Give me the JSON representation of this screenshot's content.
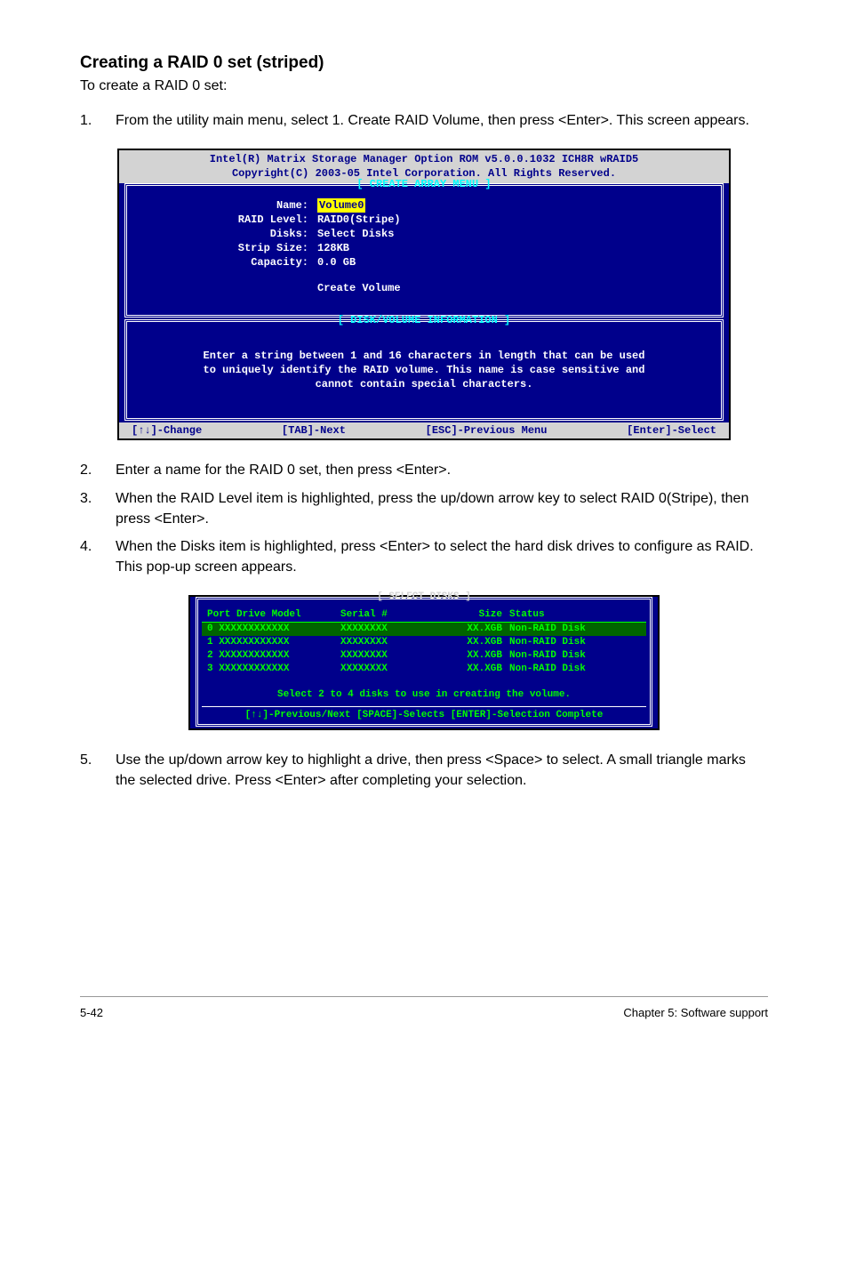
{
  "heading": "Creating a RAID 0 set (striped)",
  "intro": "To create a RAID 0 set:",
  "steps1": [
    {
      "num": "1.",
      "text": "From the utility main menu, select 1. Create RAID Volume, then press <Enter>. This screen appears."
    }
  ],
  "bios1": {
    "header1": "Intel(R) Matrix Storage Manager Option ROM v5.0.0.1032 ICH8R wRAID5",
    "header2": "Copyright(C) 2003-05 Intel Corporation. All Rights Reserved.",
    "menu_title": "[ CREATE ARRAY MENU ]",
    "fields": {
      "name_label": "Name:",
      "name_value": "Volume0",
      "raid_level_label": "RAID Level:",
      "raid_level_value": "RAID0(Stripe)",
      "disks_label": "Disks:",
      "disks_value": "Select Disks",
      "strip_label": "Strip Size:",
      "strip_value": "128KB",
      "capacity_label": "Capacity:",
      "capacity_value": "0.0   GB",
      "create_volume": "Create Volume"
    },
    "info_title": "[ DISK/VOLUME INFORMATION ]",
    "info_text1": "Enter a string between 1 and 16 characters in length that can be used",
    "info_text2": "to uniquely identify the RAID volume. This name is case sensitive and",
    "info_text3": "cannot contain special characters.",
    "footer": {
      "a": "[↑↓]-Change",
      "b": "[TAB]-Next",
      "c": "[ESC]-Previous Menu",
      "d": "[Enter]-Select"
    }
  },
  "steps2": [
    {
      "num": "2.",
      "text": "Enter a name for the RAID 0 set, then press <Enter>."
    },
    {
      "num": "3.",
      "text": "When the RAID Level item is highlighted, press the up/down arrow key to select RAID 0(Stripe), then press <Enter>."
    },
    {
      "num": "4.",
      "text": "When the Disks item is highlighted, press <Enter> to select the hard disk drives to configure as RAID. This pop-up screen appears."
    }
  ],
  "bios2": {
    "title": "[ SELECT DISKS ]",
    "head": {
      "c1": "Port Drive Model",
      "c2": "Serial #",
      "c3": "Size",
      "c4": "Status"
    },
    "rows": [
      {
        "c1": "0 XXXXXXXXXXXX",
        "c2": "XXXXXXXX",
        "c3": "XX.XGB",
        "c4": "Non-RAID Disk",
        "sel": true
      },
      {
        "c1": "1 XXXXXXXXXXXX",
        "c2": "XXXXXXXX",
        "c3": "XX.XGB",
        "c4": "Non-RAID Disk",
        "sel": false
      },
      {
        "c1": "2 XXXXXXXXXXXX",
        "c2": "XXXXXXXX",
        "c3": "XX.XGB",
        "c4": "Non-RAID Disk",
        "sel": false
      },
      {
        "c1": "3 XXXXXXXXXXXX",
        "c2": "XXXXXXXX",
        "c3": "XX.XGB",
        "c4": "Non-RAID Disk",
        "sel": false
      }
    ],
    "msg": "Select 2 to 4 disks to use in creating the volume.",
    "footer": "[↑↓]-Previous/Next  [SPACE]-Selects  [ENTER]-Selection Complete"
  },
  "steps3": [
    {
      "num": "5.",
      "text": "Use the up/down arrow key to highlight a drive, then press <Space>  to select. A small triangle marks the selected drive. Press <Enter> after completing your selection."
    }
  ],
  "page_footer": {
    "left": "5-42",
    "right": "Chapter 5: Software support"
  }
}
